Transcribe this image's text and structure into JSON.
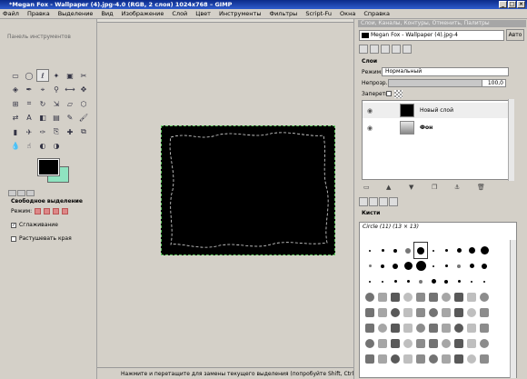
{
  "window": {
    "title": "*Megan Fox - Wallpaper (4).jpg-4.0 (RGB, 2 слоя) 1024x768 – GIMP"
  },
  "menu": [
    "Файл",
    "Правка",
    "Выделение",
    "Вид",
    "Изображение",
    "Слой",
    "Цвет",
    "Инструменты",
    "Фильтры",
    "Script-Fu",
    "Окна",
    "Справка"
  ],
  "toolbox": {
    "title": "Панель инструментов",
    "tools": [
      "rect-select",
      "ellipse-select",
      "free-select",
      "fuzzy-select",
      "color-select",
      "scissors",
      "foreground-select",
      "paths",
      "color-picker",
      "zoom",
      "measure",
      "move",
      "align",
      "crop",
      "rotate",
      "scale",
      "shear",
      "perspective",
      "flip",
      "text",
      "bucket-fill",
      "blend",
      "pencil",
      "paintbrush",
      "eraser",
      "airbrush",
      "ink",
      "clone",
      "heal",
      "perspective-clone",
      "blur",
      "smudge",
      "dodge",
      "burn"
    ],
    "selected_tool_index": 2,
    "foreground_color": "#000000",
    "background_color": "#8fe3c0",
    "options": {
      "title": "Свободное выделение",
      "mode_label": "Режим:",
      "antialias_label": "Сглаживание",
      "antialias_checked": true,
      "feather_label": "Растушевать края",
      "feather_checked": false
    }
  },
  "status": "Нажмите и перетащите для замены текущего выделения (попробуйте Shift, Ctrl, Alt)",
  "dock": {
    "title": "Слои, Каналы, Контуры, Отменить, Палитры",
    "image_selector": "Megan Fox - Wallpaper (4).jpg-4",
    "auto_label": "Авто",
    "layers_title": "Слои",
    "mode_label": "Режим:",
    "mode_value": "Нормальный",
    "opacity_label": "Непрозр.:",
    "opacity_value": "100,0",
    "opacity": 1.0,
    "lock_label": "Запереть:",
    "layers": [
      {
        "name": "Новый слой",
        "visible": true,
        "active": true
      },
      {
        "name": "Фон",
        "visible": true,
        "active": false
      }
    ],
    "brushes_title": "Кисти",
    "brush_name": "Circle (11) (13 × 13)"
  }
}
